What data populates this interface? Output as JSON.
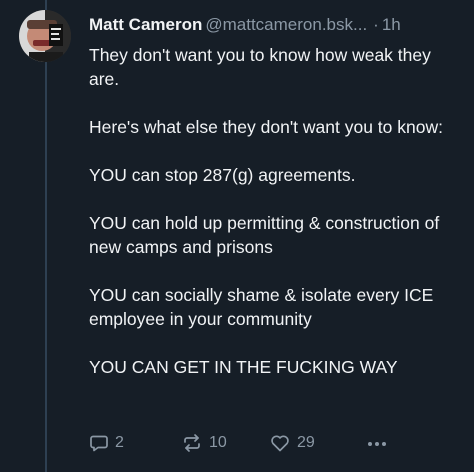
{
  "post": {
    "author_name": "Matt Cameron",
    "author_handle": "@mattcameron.bsk...",
    "separator": "·",
    "time": "1h",
    "paragraphs": [
      "They don't want you to know how weak they are.",
      "Here's what else they don't want you to know:",
      "YOU can stop 287(g) agreements.",
      "YOU can hold up permitting & construction of new camps and prisons",
      "YOU can socially shame & isolate every ICE employee in your community",
      "YOU CAN GET IN THE FUCKING WAY"
    ]
  },
  "actions": {
    "reply": {
      "icon": "reply-icon",
      "count": "2"
    },
    "repost": {
      "icon": "repost-icon",
      "count": "10"
    },
    "like": {
      "icon": "heart-icon",
      "count": "29"
    },
    "more": {
      "icon": "more-icon"
    }
  },
  "colors": {
    "background": "#161e27",
    "text": "#f1f3f5",
    "muted": "#8b98a5",
    "thread_line": "#2e4052"
  }
}
